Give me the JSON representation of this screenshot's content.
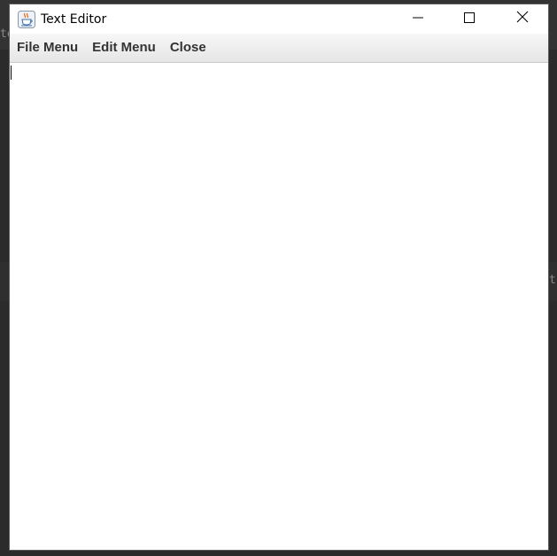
{
  "background": {
    "left_fragment": "te",
    "right_fragment": "t"
  },
  "window": {
    "title": "Text Editor",
    "icon": "java-cup-icon",
    "controls": {
      "minimize_icon": "minimize-icon",
      "maximize_icon": "maximize-icon",
      "close_icon": "close-icon"
    }
  },
  "menubar": {
    "items": [
      {
        "label": "File Menu"
      },
      {
        "label": "Edit Menu"
      },
      {
        "label": "Close"
      }
    ]
  },
  "editor": {
    "content": ""
  },
  "colors": {
    "desktop": "#2b2b2b",
    "menubar_top": "#f7f7f7",
    "menubar_bottom": "#e6e6e6",
    "menu_text": "#333333"
  }
}
